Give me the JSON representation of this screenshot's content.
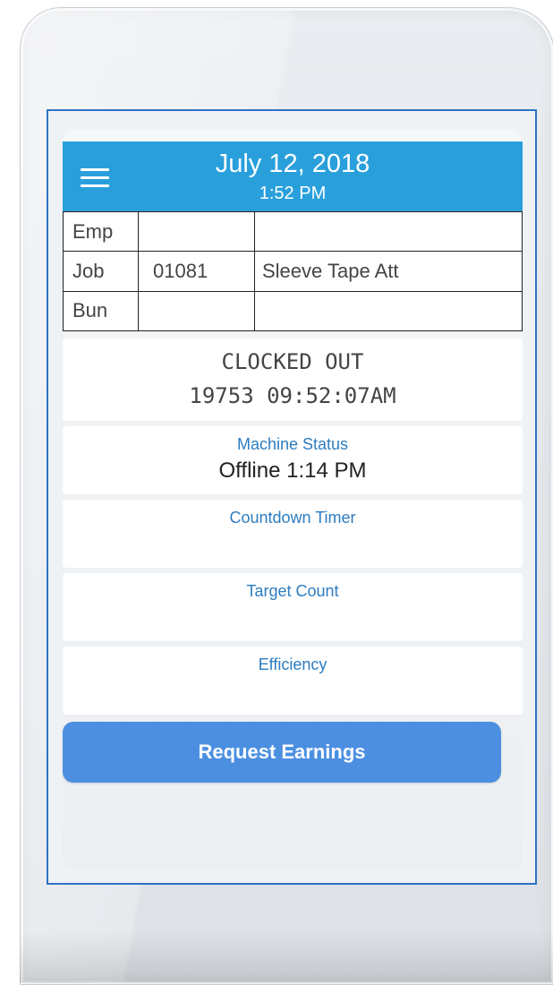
{
  "header": {
    "date": "July 12, 2018",
    "time": "1:52 PM"
  },
  "info_table": [
    {
      "label": "Emp",
      "code": "",
      "desc": ""
    },
    {
      "label": "Job",
      "code": "01081",
      "desc": "Sleeve Tape Att"
    },
    {
      "label": "Bun",
      "code": "",
      "desc": ""
    }
  ],
  "clock_status": {
    "status": "CLOCKED OUT",
    "detail": "19753 09:52:07AM"
  },
  "machine_status": {
    "label": "Machine Status",
    "value": "Offline 1:14 PM"
  },
  "countdown_timer": {
    "label": "Countdown Timer",
    "value": ""
  },
  "target_count": {
    "label": "Target Count",
    "value": ""
  },
  "efficiency": {
    "label": "Efficiency",
    "value": ""
  },
  "actions": {
    "request_earnings": "Request Earnings"
  },
  "colors": {
    "header_bg": "#29a0dc",
    "label_blue": "#2d7cc0",
    "button_bg": "#4c8fe1",
    "screen_border": "#2f72c4"
  },
  "icons": {
    "menu": "hamburger-menu-icon"
  }
}
